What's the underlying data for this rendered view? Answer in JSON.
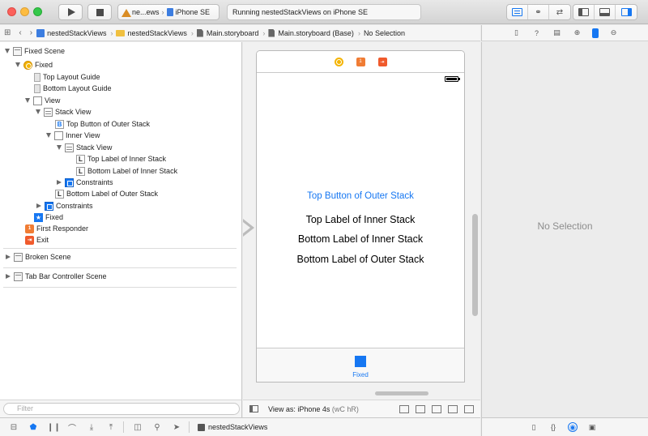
{
  "toolbar": {
    "scheme_app": "ne...ews",
    "scheme_device": "iPhone SE",
    "activity": "Running nestedStackViews on iPhone SE"
  },
  "jumpbar": {
    "crumbs": [
      "nestedStackViews",
      "nestedStackViews",
      "Main.storyboard",
      "Main.storyboard (Base)",
      "No Selection"
    ]
  },
  "outline": {
    "rows": [
      {
        "label": "Fixed Scene"
      },
      {
        "label": "Fixed"
      },
      {
        "label": "Top Layout Guide"
      },
      {
        "label": "Bottom Layout Guide"
      },
      {
        "label": "View"
      },
      {
        "label": "Stack View"
      },
      {
        "label": "Top Button of Outer Stack",
        "badge": "B"
      },
      {
        "label": "Inner View"
      },
      {
        "label": "Stack View"
      },
      {
        "label": "Top Label of Inner Stack",
        "badge": "L"
      },
      {
        "label": "Bottom Label of Inner Stack",
        "badge": "L"
      },
      {
        "label": "Constraints"
      },
      {
        "label": "Bottom Label of Outer Stack",
        "badge": "L"
      },
      {
        "label": "Constraints"
      },
      {
        "label": "Fixed",
        "badge": "★"
      },
      {
        "label": "First Responder",
        "badge": "1"
      },
      {
        "label": "Exit",
        "badge": "⇥"
      },
      {
        "label": "Broken Scene"
      },
      {
        "label": "Tab Bar Controller Scene"
      }
    ],
    "filter_placeholder": "Filter"
  },
  "canvas": {
    "top_button": "Top Button of Outer Stack",
    "top_label_inner": "Top Label of Inner Stack",
    "bottom_label_inner": "Bottom Label of Inner Stack",
    "bottom_label_outer": "Bottom Label of Outer Stack",
    "tab_label": "Fixed",
    "view_as_prefix": "View as: iPhone 4s",
    "view_as_suffix": "(wC hR)"
  },
  "inspector": {
    "no_selection": "No Selection"
  },
  "debug": {
    "project": "nestedStackViews"
  },
  "colors": {
    "accent": "#1677f2",
    "vc_yellow": "#f4b400",
    "responder_orange": "#f07c34",
    "exit_red": "#f05a2c"
  }
}
